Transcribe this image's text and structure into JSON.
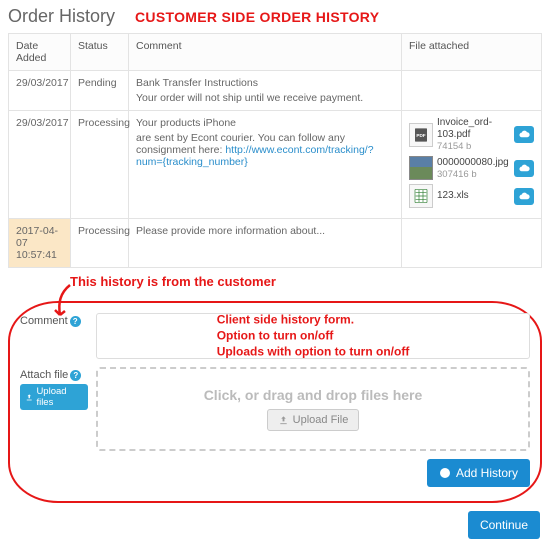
{
  "page_title": "Order History",
  "overlay_title": "CUSTOMER SIDE ORDER HISTORY",
  "columns": {
    "date": "Date Added",
    "status": "Status",
    "comment": "Comment",
    "file": "File attached"
  },
  "rows": [
    {
      "date": "29/03/2017",
      "status": "Pending",
      "comment_line1": "Bank Transfer Instructions",
      "comment_line2": "Your order will not ship until we receive payment."
    },
    {
      "date": "29/03/2017",
      "status": "Processing",
      "comment_line1": "Your products iPhone",
      "comment_line2": "are sent by Econt courier. You can follow any consignment here: ",
      "link_text": "http://www.econt.com/tracking/?num={tracking_number}",
      "files": [
        {
          "name": "Invoice_ord-103.pdf",
          "size": "74154 b",
          "thumb": "pdf"
        },
        {
          "name": "0000000080.jpg",
          "size": "307416 b",
          "thumb": "img"
        },
        {
          "name": "123.xls",
          "size": "",
          "thumb": "xls"
        }
      ]
    },
    {
      "date": "2017-04-07 10:57:41",
      "status": "Processing",
      "comment_line1": "Please provide more information about...",
      "highlight": true
    }
  ],
  "annotation_customer": "This history is from the customer",
  "form": {
    "comment_label": "Comment",
    "attach_label": "Attach file",
    "upload_chip": "Upload files",
    "overlay_line1": "Client side history form.",
    "overlay_line2": "Option to turn on/off",
    "overlay_line3": "Uploads with option to turn on/off",
    "dropzone_text": "Click, or drag and drop files here",
    "dropzone_btn": "Upload File",
    "add_history_btn": "Add History"
  },
  "continue_btn": "Continue"
}
